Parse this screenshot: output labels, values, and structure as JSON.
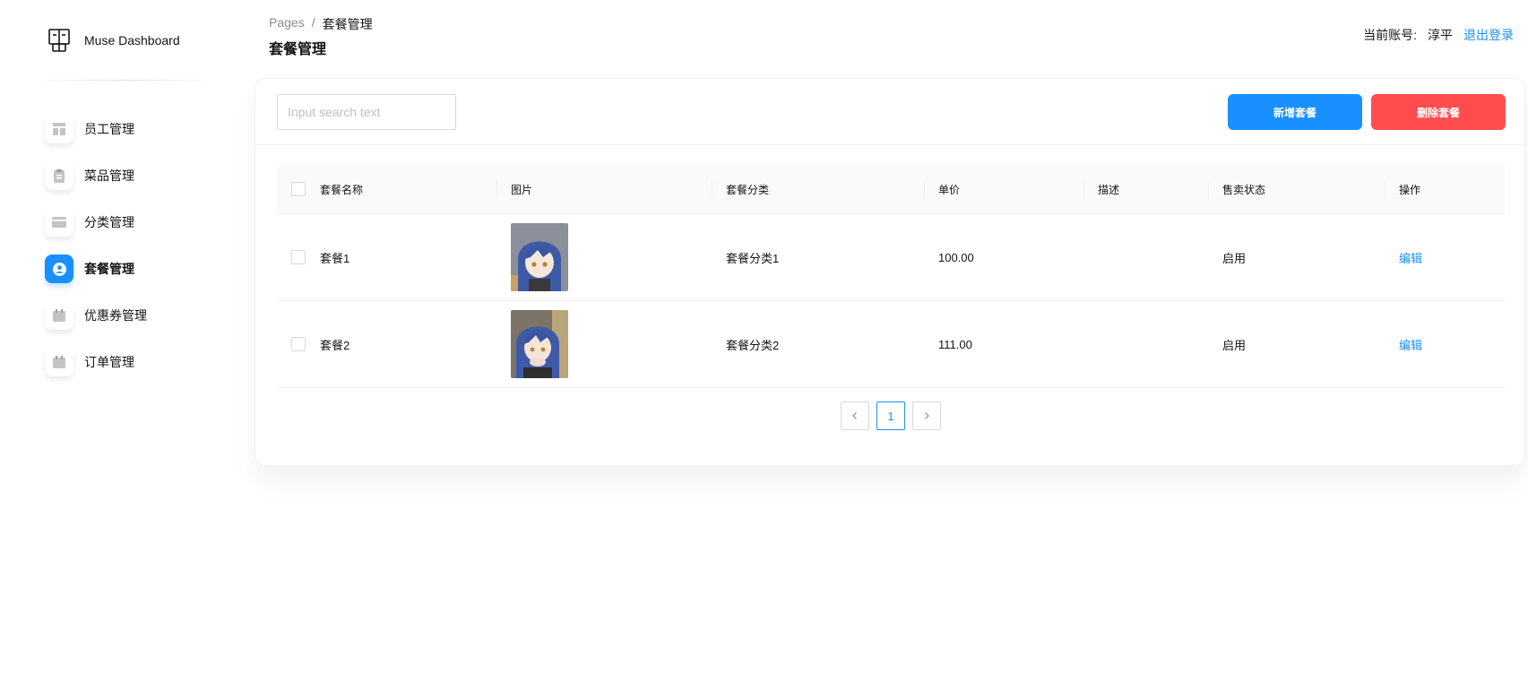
{
  "brand": {
    "name": "Muse Dashboard",
    "logo_icon": "dashboard-logo-icon"
  },
  "sidebar": {
    "items": [
      {
        "label": "员工管理",
        "icon": "layout-icon",
        "active": false
      },
      {
        "label": "菜品管理",
        "icon": "clipboard-icon",
        "active": false
      },
      {
        "label": "分类管理",
        "icon": "credit-card-icon",
        "active": false
      },
      {
        "label": "套餐管理",
        "icon": "user-circle-icon",
        "active": true
      },
      {
        "label": "优惠券管理",
        "icon": "calendar-icon",
        "active": false
      },
      {
        "label": "订单管理",
        "icon": "calendar-icon",
        "active": false
      }
    ]
  },
  "header": {
    "breadcrumb": {
      "root": "Pages",
      "separator": "/",
      "current": "套餐管理"
    },
    "title": "套餐管理",
    "account_label": "当前账号:",
    "account_name": "淳平",
    "logout_label": "退出登录"
  },
  "toolbar": {
    "search_placeholder": "Input search text",
    "add_label": "新增套餐",
    "delete_label": "删除套餐"
  },
  "table": {
    "columns": [
      "套餐名称",
      "图片",
      "套餐分类",
      "单价",
      "描述",
      "售卖状态",
      "操作"
    ],
    "rows": [
      {
        "name": "套餐1",
        "category": "套餐分类1",
        "price": "100.00",
        "description": "",
        "status": "启用",
        "action": "编辑"
      },
      {
        "name": "套餐2",
        "category": "套餐分类2",
        "price": "111.00",
        "description": "",
        "status": "启用",
        "action": "编辑"
      }
    ]
  },
  "pagination": {
    "prev": "<",
    "current": "1",
    "next": ">"
  },
  "colors": {
    "primary": "#1890ff",
    "danger": "#ff4d4f"
  }
}
